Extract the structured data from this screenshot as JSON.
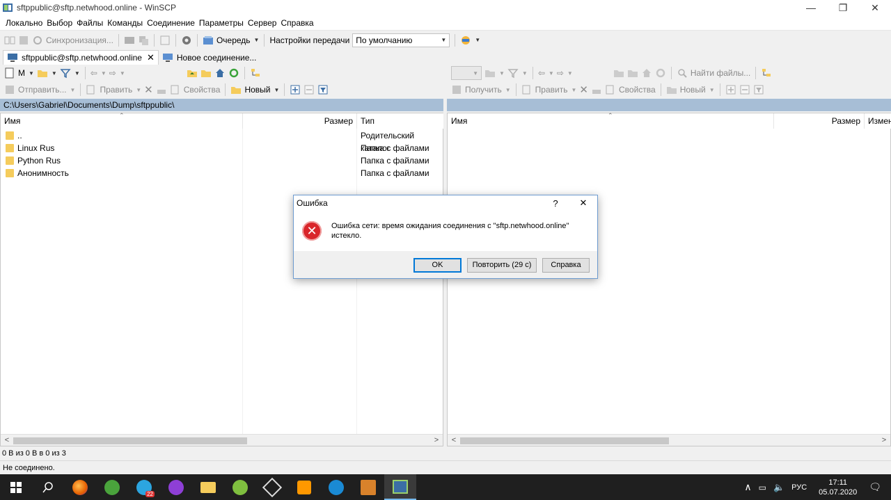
{
  "window": {
    "title": "sftppublic@sftp.netwhood.online - WinSCP",
    "controls": [
      "—",
      "❐",
      "✕"
    ]
  },
  "menu": [
    "Локально",
    "Выбор",
    "Файлы",
    "Команды",
    "Соединение",
    "Параметры",
    "Сервер",
    "Справка"
  ],
  "toolbar": {
    "sync_label": "Синхронизация...",
    "queue_label": "Очередь",
    "transfer_settings_label": "Настройки передачи",
    "transfer_preset": "По умолчанию"
  },
  "tabs": [
    {
      "label": "sftppublic@sftp.netwhood.online",
      "active": true,
      "close": "✕"
    },
    {
      "label": "Новое соединение...",
      "active": false
    }
  ],
  "left": {
    "drive_label": "М",
    "send_label": "Отправить...",
    "edit_label": "Править",
    "properties_label": "Свойства",
    "new_label": "Новый",
    "path": "C:\\Users\\Gabriel\\Documents\\Dump\\sftppublic\\",
    "columns": {
      "name": "Имя",
      "size": "Размер",
      "type": "Тип"
    },
    "rows": [
      {
        "name": "..",
        "type": "Родительский каталог",
        "parent": true
      },
      {
        "name": "Linux Rus",
        "type": "Папка с файлами"
      },
      {
        "name": "Python Rus",
        "type": "Папка с файлами"
      },
      {
        "name": "Анонимность",
        "type": "Папка с файлами"
      }
    ]
  },
  "right": {
    "find_files_label": "Найти файлы...",
    "get_label": "Получить",
    "edit_label": "Править",
    "properties_label": "Свойства",
    "new_label": "Новый",
    "columns": {
      "name": "Имя",
      "size": "Размер",
      "modified": "Измен"
    }
  },
  "status": {
    "selection": "0 В из 0 В в 0 из 3",
    "connection": "Не соединено."
  },
  "dialog": {
    "title": "Ошибка",
    "help_glyph": "?",
    "close_glyph": "✕",
    "message": "Ошибка сети: время ожидания соединения с \"sftp.netwhood.online\" истекло.",
    "buttons": {
      "ok": "OK",
      "retry": "Повторить (29 с)",
      "help": "Справка"
    }
  },
  "taskbar": {
    "language": "РУС",
    "time": "17:11",
    "date": "05.07.2020",
    "telegram_badge": "22"
  },
  "colors": {
    "address_bar": "#a7bed6",
    "error_red": "#d9262b",
    "taskbar": "#1f1f1f",
    "accent": "#0078d7"
  }
}
